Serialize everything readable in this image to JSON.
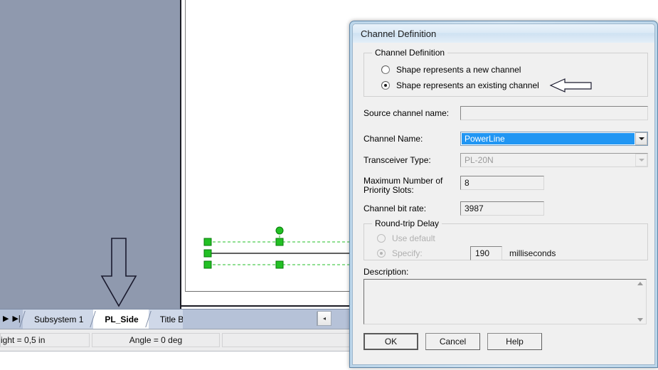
{
  "app": {
    "tabs_nav": {
      "next_icon": "▶",
      "last_icon": "▶|"
    },
    "tabs": [
      {
        "label": "Subsystem 1",
        "active": false
      },
      {
        "label": "PL_Side",
        "active": true
      },
      {
        "label": "Title Blocks",
        "active": false
      }
    ],
    "scroll_left_icon": "◂",
    "status": {
      "panel1": "ight = 0,5 in",
      "panel2": "Angle = 0 deg",
      "panel3": ""
    },
    "canvas": {
      "annotation_arrow": "down-arrow-annotation",
      "selected_shape": "selected-line-shape"
    }
  },
  "dialog": {
    "title": "Channel Definition",
    "group_channel_definition": {
      "title": "Channel Definition",
      "options": [
        {
          "label": "Shape represents a new channel",
          "selected": false
        },
        {
          "label": "Shape represents an existing channel",
          "selected": true
        }
      ],
      "annotation_arrow": "left-arrow-annotation"
    },
    "fields": {
      "source_channel_name": {
        "label": "Source channel name:",
        "value": ""
      },
      "channel_name": {
        "label": "Channel Name:",
        "value": "PowerLine",
        "highlight_color": "#2196f3"
      },
      "transceiver_type": {
        "label": "Transceiver Type:",
        "value": "PL-20N",
        "disabled": true
      },
      "max_priority_slots": {
        "label_line1": "Maximum  Number of",
        "label_line2": "Priority Slots:",
        "value": "8"
      },
      "channel_bit_rate": {
        "label": "Channel bit rate:",
        "value": "3987"
      }
    },
    "group_round_trip_delay": {
      "title": "Round-trip Delay",
      "use_default_label": "Use default",
      "use_default_selected": false,
      "specify_label": "Specify:",
      "specify_selected": true,
      "specify_value": "190",
      "units_label": "milliseconds"
    },
    "description": {
      "label": "Description:",
      "value": ""
    },
    "buttons": {
      "ok": "OK",
      "cancel": "Cancel",
      "help": "Help"
    }
  }
}
